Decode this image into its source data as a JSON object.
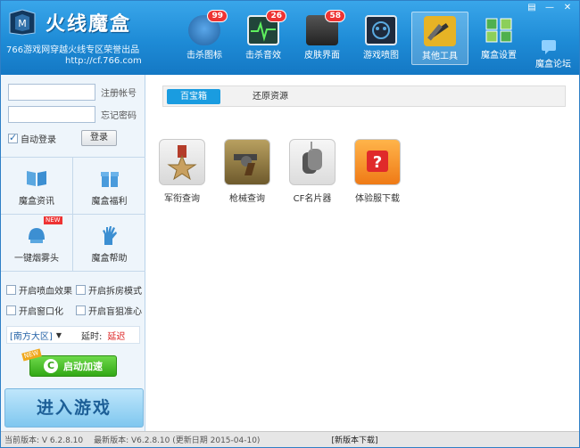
{
  "app": {
    "title": "火线魔盒",
    "subtitle": "766游戏网穿越火线专区荣誉出品",
    "url": "http://cf.766.com"
  },
  "top_nav": [
    {
      "label": "击杀图标",
      "badge": "99",
      "icon": "kill-icon-shield",
      "color": "#2e6fb4"
    },
    {
      "label": "击杀音效",
      "badge": "26",
      "icon": "heartbeat-monitor-icon",
      "color": "#21453a"
    },
    {
      "label": "皮肤界面",
      "badge": "58",
      "icon": "soldier-skin-icon",
      "color": "#3a3a3a"
    },
    {
      "label": "游戏喷图",
      "badge": "",
      "icon": "spray-mask-icon",
      "color": "#1e2a3d"
    },
    {
      "label": "其他工具",
      "badge": "",
      "icon": "tools-icon",
      "color": "#e7b325",
      "active": true
    },
    {
      "label": "魔盒设置",
      "badge": "",
      "icon": "settings-grid-icon",
      "color": "#4fb04f"
    },
    {
      "label": "魔盒论坛",
      "badge": "",
      "icon": "forum-icon",
      "color": "#2a88d0"
    }
  ],
  "login": {
    "register_link": "注册帐号",
    "forgot_link": "忘记密码",
    "auto_login": "自动登录",
    "login_button": "登录"
  },
  "sidebar_grid": [
    {
      "label": "魔盒资讯",
      "icon": "news-book-icon"
    },
    {
      "label": "魔盒福利",
      "icon": "gift-icon"
    },
    {
      "label": "一键烟雾头",
      "icon": "smoke-helmet-icon",
      "tag": "NEW"
    },
    {
      "label": "魔盒帮助",
      "icon": "help-hand-icon"
    }
  ],
  "options": [
    {
      "label": "开启喷血效果",
      "checked": false
    },
    {
      "label": "开启拆房模式",
      "checked": false
    },
    {
      "label": "开启窗口化",
      "checked": false
    },
    {
      "label": "开启盲狙准心",
      "checked": false
    }
  ],
  "server": {
    "name": "[南方大区]",
    "latency_label": "延时:",
    "latency_value": "延迟"
  },
  "accelerate": {
    "label": "启动加速",
    "tag": "NEW"
  },
  "enter_game": "进入游戏",
  "tabs": [
    {
      "label": "百宝箱",
      "active": true
    },
    {
      "label": "还原资源",
      "active": false
    }
  ],
  "tools": [
    {
      "label": "军衔查询",
      "icon": "medal-icon"
    },
    {
      "label": "枪械查询",
      "icon": "revolver-icon"
    },
    {
      "label": "CF名片器",
      "icon": "dogtag-icon"
    },
    {
      "label": "体验服下载",
      "icon": "question-box-icon"
    }
  ],
  "status": {
    "current_version": "当前版本: V 6.2.8.10",
    "latest_version": "最新版本: V6.2.8.10 (更新日期 2015-04-10)",
    "download_link": "[新版本下载]"
  }
}
